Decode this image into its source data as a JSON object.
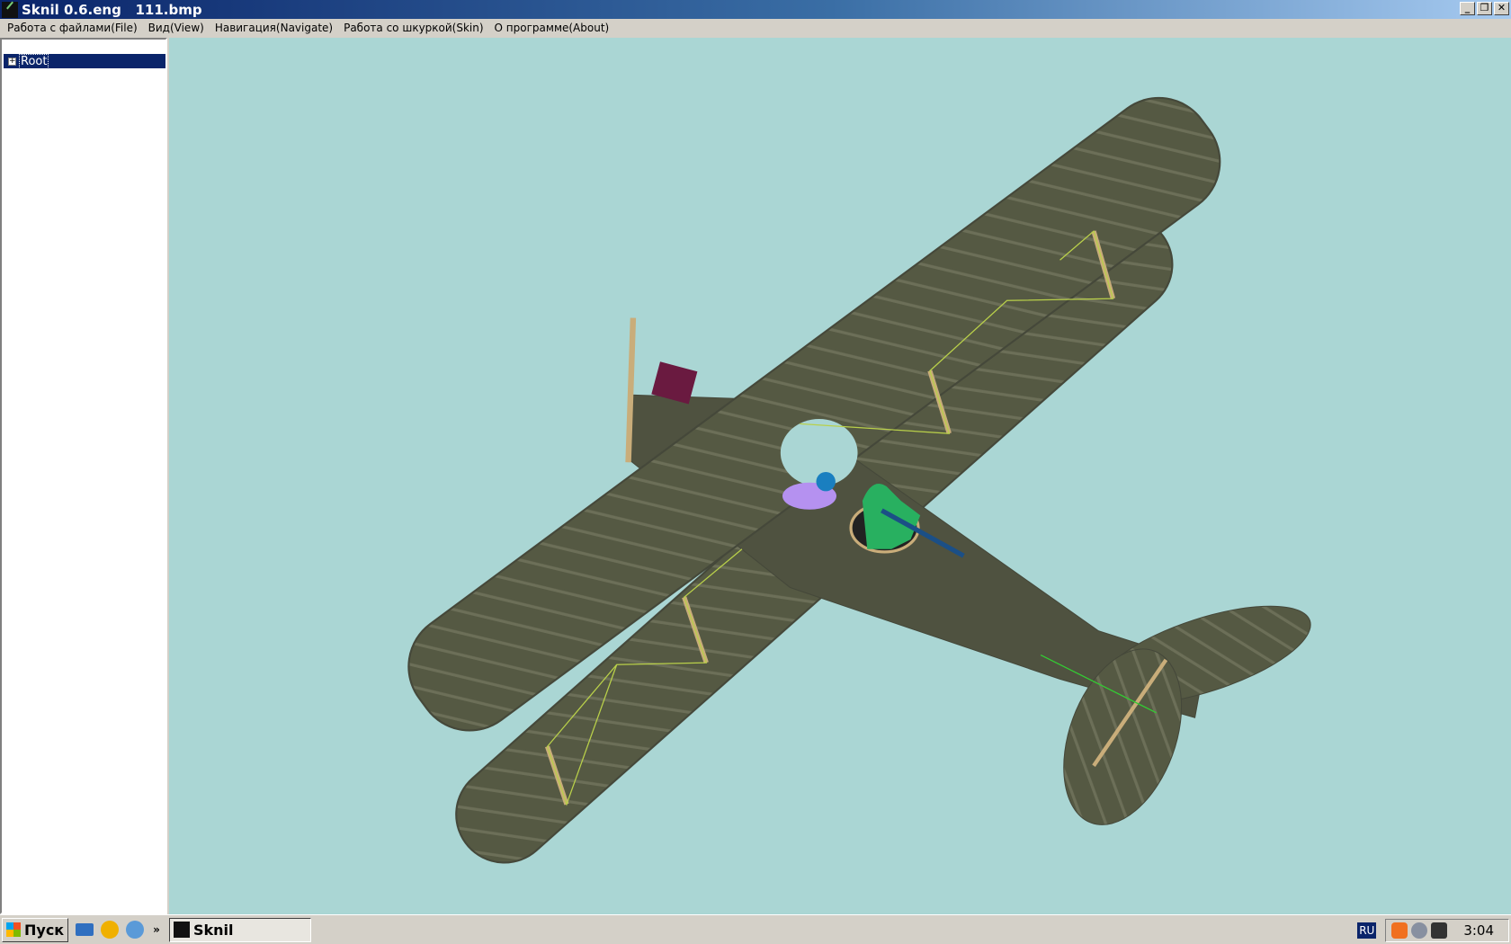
{
  "window": {
    "title": "Sknil 0.6.eng   111.bmp",
    "buttons": [
      "_",
      "❐",
      "✕"
    ]
  },
  "menu": [
    "Работа с файлами(File)",
    "Вид(View)",
    "Навигация(Navigate)",
    "Работа со шкуркой(Skin)",
    "О программе(About)"
  ],
  "tree": {
    "expander": "+",
    "root": "Root"
  },
  "viewport": {
    "background": "#aad6d4",
    "model": "biplane"
  },
  "taskbar": {
    "start": "Пуск",
    "quick_launch": [
      "show-desktop-icon",
      "aimp-icon",
      "media-player-icon"
    ],
    "overflow": "»",
    "task": "Sknil",
    "lang": "RU",
    "tray": [
      "avast-icon",
      "webcam-icon",
      "safely-remove-icon"
    ],
    "clock": "3:04"
  }
}
